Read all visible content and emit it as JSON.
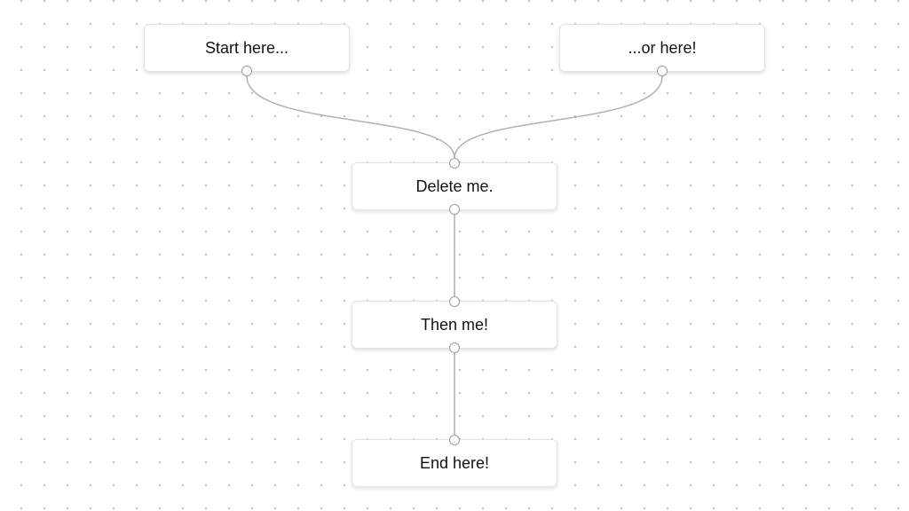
{
  "diagram": {
    "nodes": [
      {
        "id": "start",
        "label": "Start here..."
      },
      {
        "id": "or",
        "label": "...or here!"
      },
      {
        "id": "delete",
        "label": "Delete me."
      },
      {
        "id": "then",
        "label": "Then me!"
      },
      {
        "id": "end",
        "label": "End here!"
      }
    ],
    "edges": [
      {
        "from": "start",
        "to": "delete"
      },
      {
        "from": "or",
        "to": "delete"
      },
      {
        "from": "delete",
        "to": "then"
      },
      {
        "from": "then",
        "to": "end"
      }
    ],
    "colors": {
      "edge": "#b1b1b1",
      "handle_border": "#9a9a9a",
      "dot_grid": "#b9b9b9"
    }
  }
}
